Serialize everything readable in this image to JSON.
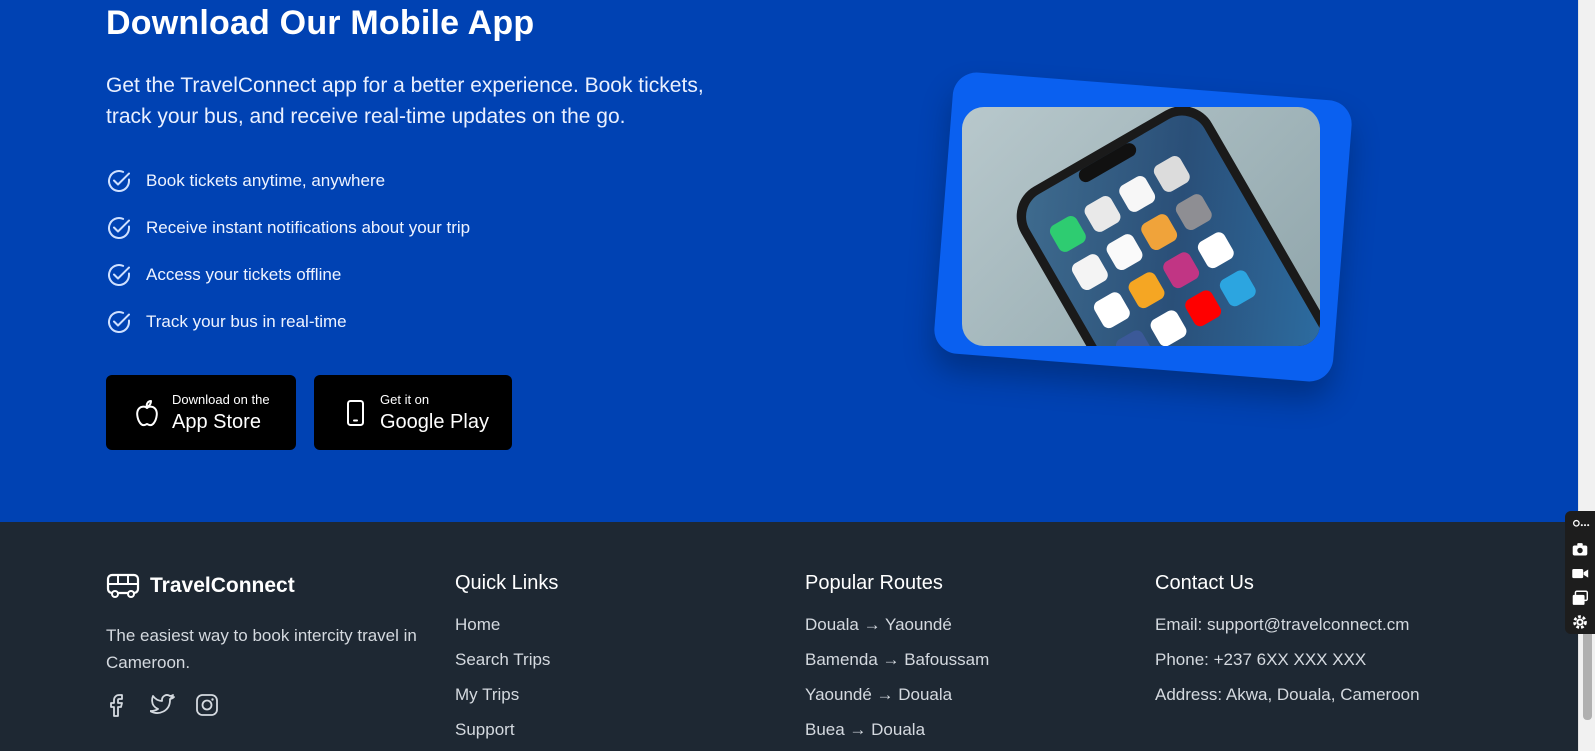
{
  "promo": {
    "title": "Download Our Mobile App",
    "lead": "Get the TravelConnect app for a better experience. Book tickets, track your bus, and receive real-time updates on the go.",
    "features": [
      "Book tickets anytime, anywhere",
      "Receive instant notifications about your trip",
      "Access your tickets offline",
      "Track your bus in real-time"
    ],
    "app_store": {
      "small": "Download on the",
      "big": "App Store",
      "icon": "apple-icon"
    },
    "google_play": {
      "small": "Get it on",
      "big": "Google Play",
      "icon": "phone-icon"
    },
    "image_icon": "smartphone-photo"
  },
  "footer": {
    "brand": "TravelConnect",
    "description": "The easiest way to book intercity travel in Cameroon.",
    "social_icons": [
      "facebook-icon",
      "twitter-icon",
      "instagram-icon"
    ],
    "quick_links": {
      "title": "Quick Links",
      "items": [
        "Home",
        "Search Trips",
        "My Trips",
        "Support"
      ]
    },
    "popular_routes": {
      "title": "Popular Routes",
      "items": [
        "Douala → Yaoundé",
        "Bamenda → Bafoussam",
        "Yaoundé → Douala",
        "Buea → Douala"
      ]
    },
    "contact": {
      "title": "Contact Us",
      "items": [
        "Email: support@travelconnect.cm",
        "Phone: +237 6XX XXX XXX",
        "Address: Akwa, Douala, Cameroon"
      ]
    }
  },
  "colors": {
    "promo_bg": "#0042b3",
    "footer_bg": "#1e2833",
    "accent_card": "#0a60f0",
    "button_bg": "#000000"
  }
}
